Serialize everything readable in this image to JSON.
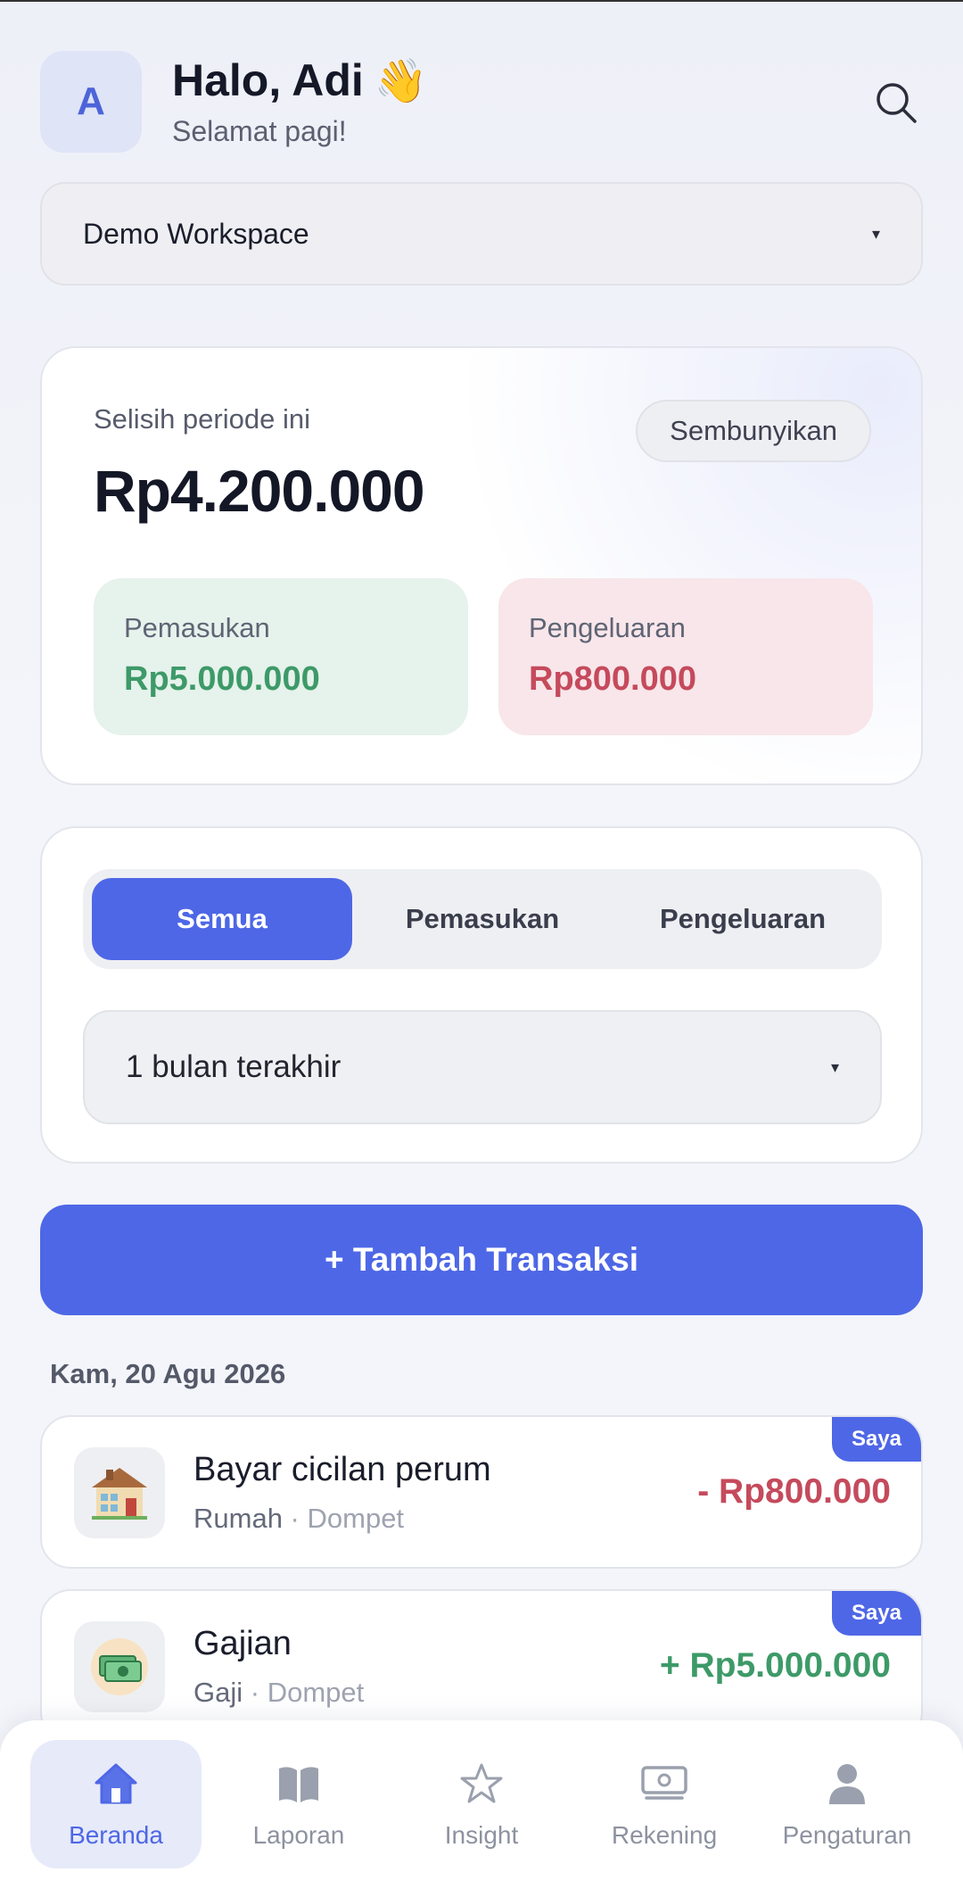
{
  "header": {
    "avatar_initial": "A",
    "greeting": "Halo, Adi",
    "wave_emoji": "👋",
    "subtitle": "Selamat pagi!"
  },
  "workspace": {
    "label": "Demo Workspace",
    "caret": "▾"
  },
  "summary": {
    "label": "Selisih periode ini",
    "amount": "Rp4.200.000",
    "hide_button": "Sembunyikan",
    "income": {
      "label": "Pemasukan",
      "value": "Rp5.000.000"
    },
    "expense": {
      "label": "Pengeluaran",
      "value": "Rp800.000"
    }
  },
  "filter": {
    "tabs": [
      "Semua",
      "Pemasukan",
      "Pengeluaran"
    ],
    "active_tab": "Semua",
    "period": "1 bulan terakhir",
    "caret": "▾"
  },
  "add_button": "+ Tambah Transaksi",
  "transactions_date": "Kam, 20 Agu 2026",
  "transactions": [
    {
      "title": "Bayar cicilan perum",
      "category": "Rumah",
      "separator": " · ",
      "account": "Dompet",
      "amount": "- Rp800.000",
      "badge": "Saya",
      "icon": "house-icon"
    },
    {
      "title": "Gajian",
      "category": "Gaji",
      "separator": " · ",
      "account": "Dompet",
      "amount": "+ Rp5.000.000",
      "badge": "Saya",
      "icon": "money-icon"
    }
  ],
  "nav": [
    {
      "label": "Beranda",
      "icon": "home-icon",
      "active": true
    },
    {
      "label": "Laporan",
      "icon": "book-icon",
      "active": false
    },
    {
      "label": "Insight",
      "icon": "star-icon",
      "active": false
    },
    {
      "label": "Rekening",
      "icon": "cash-icon",
      "active": false
    },
    {
      "label": "Pengaturan",
      "icon": "user-icon",
      "active": false
    }
  ],
  "colors": {
    "primary": "#4e67e6",
    "income": "#3d9a68",
    "expense": "#c54a5c",
    "background": "#f4f5fa"
  }
}
